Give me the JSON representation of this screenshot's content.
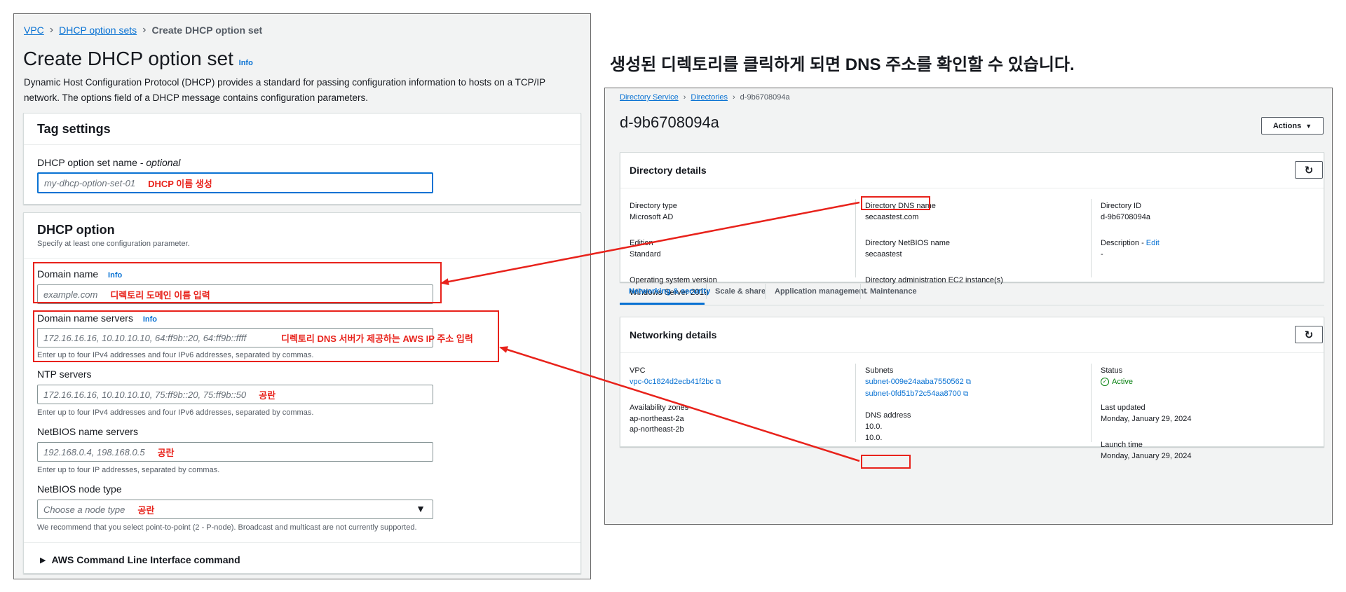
{
  "dhcp": {
    "breadcrumb": [
      "VPC",
      "DHCP option sets",
      "Create DHCP option set"
    ],
    "title": "Create DHCP option set",
    "info": "Info",
    "description_line1": "Dynamic Host Configuration Protocol (DHCP) provides a standard for passing configuration information to hosts on a TCP/IP",
    "description_line2": "network. The options field of a DHCP message contains configuration parameters.",
    "tag_settings": {
      "header": "Tag settings",
      "name_label": "DHCP option set name - ",
      "name_optional": "optional",
      "name_placeholder": "my-dhcp-option-set-01",
      "name_annotation": "DHCP 이름 생성"
    },
    "option": {
      "header": "DHCP option",
      "subheader": "Specify at least one configuration parameter.",
      "domain_name_label": "Domain name",
      "domain_name_placeholder": "example.com",
      "domain_name_annotation": "디렉토리 도메인 이름 입력",
      "dns_label": "Domain name servers",
      "dns_placeholder": "172.16.16.16, 10.10.10.10, 64:ff9b::20, 64:ff9b::ffff",
      "dns_annotation": "디렉토리 DNS 서버가 제공하는 AWS IP 주소 입력",
      "dns_hint": "Enter up to four IPv4 addresses and four IPv6 addresses, separated by commas.",
      "ntp_label": "NTP servers",
      "ntp_placeholder": "172.16.16.16, 10.10.10.10, 75:ff9b::20, 75:ff9b::50",
      "ntp_annotation": "공란",
      "ntp_hint": "Enter up to four IPv4 addresses and four IPv6 addresses, separated by commas.",
      "netbios_label": "NetBIOS name servers",
      "netbios_placeholder": "192.168.0.4, 198.168.0.5",
      "netbios_annotation": "공란",
      "netbios_hint": "Enter up to four IP addresses, separated by commas.",
      "nodetype_label": "NetBIOS node type",
      "nodetype_placeholder": "Choose a node type",
      "nodetype_annotation": "공란",
      "nodetype_hint": "We recommend that you select point-to-point (2 - P-node). Broadcast and multicast are not currently supported.",
      "cli_label": "AWS Command Line Interface command"
    }
  },
  "caption": "생성된 디렉토리를 클릭하게 되면 DNS 주소를 확인할 수 있습니다.",
  "directory": {
    "breadcrumb": [
      "Directory Service",
      "Directories",
      "d-9b6708094a"
    ],
    "title": "d-9b6708094a",
    "actions_label": "Actions",
    "details": {
      "header": "Directory details",
      "type_label": "Directory type",
      "type_value": "Microsoft AD",
      "edition_label": "Edition",
      "edition_value": "Standard",
      "os_label": "Operating system version",
      "os_value": "Windows Server 2019",
      "dns_name_label": "Directory DNS name",
      "dns_name_value": "secaastest.com",
      "netbios_label": "Directory NetBIOS name",
      "netbios_value": "secaastest",
      "ec2_label": "Directory administration EC2 instance(s)",
      "ec2_value": "-",
      "id_label": "Directory ID",
      "id_value": "d-9b6708094a",
      "desc_label": "Description - ",
      "desc_edit": "Edit",
      "desc_value": "-"
    },
    "tabs": [
      "Networking & security",
      "Scale & share",
      "Application management",
      "Maintenance"
    ],
    "networking": {
      "header": "Networking details",
      "vpc_label": "VPC",
      "vpc_value": "vpc-0c1824d2ecb41f2bc",
      "az_label": "Availability zones",
      "az_values": [
        "ap-northeast-2a",
        "ap-northeast-2b"
      ],
      "subnets_label": "Subnets",
      "subnets": [
        "subnet-009e24aaba7550562",
        "subnet-0fd51b72c54aa8700"
      ],
      "dns_address_label": "DNS address",
      "dns_addresses": [
        "10.0.",
        "10.0."
      ],
      "status_label": "Status",
      "status_value": "Active",
      "updated_label": "Last updated",
      "updated_value": "Monday, January 29, 2024",
      "launch_label": "Launch time",
      "launch_value": "Monday, January 29, 2024"
    }
  },
  "colors": {
    "annotation": "#e8221b",
    "link": "#0972d3",
    "active": "#037f0c"
  }
}
